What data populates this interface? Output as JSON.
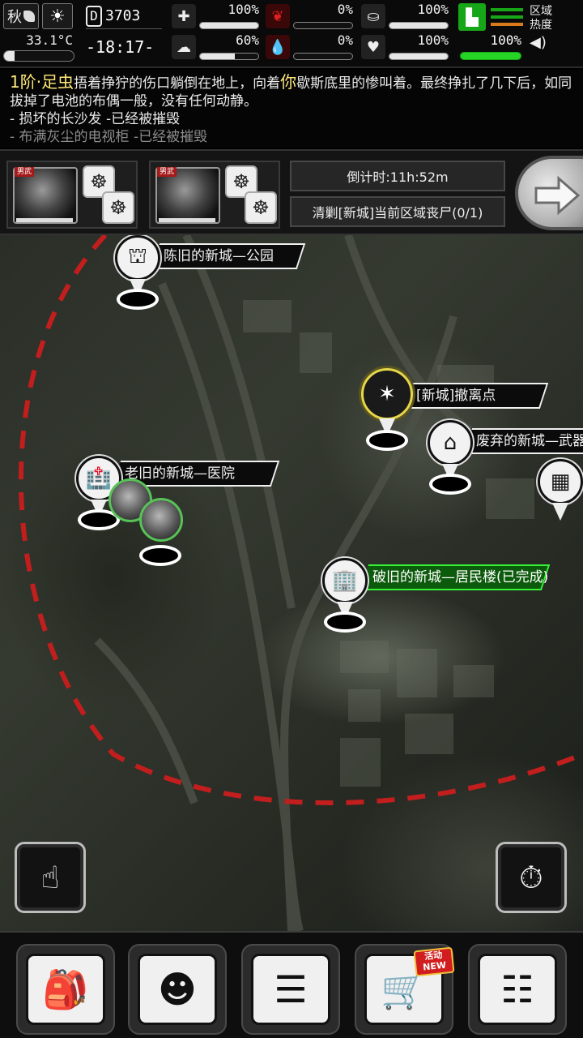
{
  "status": {
    "season": "秋",
    "weather_icon": "sun-icon",
    "temperature": "33.1°C",
    "temperature_level": 0.15,
    "day_prefix": "D",
    "day": "3703",
    "time": "-18:17-",
    "stats": [
      {
        "name": "medical",
        "icon": "first-aid-kit-icon",
        "value": "100%",
        "level": 1.0
      },
      {
        "name": "hunger",
        "icon": "stomach-icon",
        "value": "0%",
        "level": 0.0,
        "color": "#e02020"
      },
      {
        "name": "drink",
        "icon": "canteen-icon",
        "value": "100%",
        "level": 1.0
      },
      {
        "name": "mood",
        "icon": "brain-icon",
        "value": "60%",
        "level": 0.6
      },
      {
        "name": "thirst",
        "icon": "water-drop-icon",
        "value": "0%",
        "level": 0.0,
        "color": "#e02020"
      },
      {
        "name": "health",
        "icon": "heart-icon",
        "value": "100%",
        "level": 1.0
      }
    ],
    "stamina": {
      "icon": "boot-icon",
      "value": "100%",
      "level": 1.0,
      "color": "#26d426"
    },
    "zone_heat_label": "区域\n热度",
    "sound_icon": "speaker-icon"
  },
  "log": {
    "line1_tier": "1阶·足虫",
    "line1_mid": "捂着挣狞的伤口躺倒在地上，向着",
    "line1_you": "你",
    "line1_rest": "歇斯底里的惨叫着。最终挣扎了几下后，如同拔掉了电池的布偶一般，没有任何动静。",
    "line2": "- 损坏的长沙发 -已经被摧毁",
    "line3": "- 布满灰尘的电视柜 -已经被摧毁"
  },
  "party": {
    "members": [
      {
        "tag": "男武",
        "skill_icons": [
          "tribal-mask-icon",
          "tribal-mask-icon"
        ]
      },
      {
        "tag": "男武",
        "skill_icons": [
          "tribal-mask-icon",
          "tribal-mask-icon"
        ]
      }
    ],
    "countdown": "倒计时:11h:52m",
    "objective": "清剿[新城]当前区域丧尸(0/1)",
    "go_icon": "arrow-right-icon"
  },
  "map": {
    "locations": [
      {
        "label": "陈旧的新城—公园",
        "icon": "park-gate-icon"
      },
      {
        "label": "[新城]撤离点",
        "icon": "evacuation-icon",
        "highlight": "gold"
      },
      {
        "label": "废弃的新城—武器",
        "icon": "shop-icon"
      },
      {
        "label": "老旧的新城—医院",
        "icon": "hospital-icon"
      },
      {
        "label": "破旧的新城—居民楼(已完成)",
        "icon": "apartment-icon",
        "highlight": "green"
      },
      {
        "label": "",
        "icon": "warehouse-icon"
      }
    ],
    "zone_ring_color": "#c21e1e",
    "quick_action_icon": "tap-hand-arrow-icon",
    "wait_icon": "stopwatch-icon"
  },
  "toolbar": {
    "buttons": [
      {
        "name": "backpack",
        "icon": "backpack-icon"
      },
      {
        "name": "skills",
        "icon": "head-brain-icon"
      },
      {
        "name": "notes",
        "icon": "notebook-icon"
      },
      {
        "name": "shop",
        "icon": "shopping-cart-icon",
        "badge_top": "活动",
        "badge_bottom": "NEW"
      },
      {
        "name": "menu",
        "icon": "list-menu-icon"
      }
    ]
  }
}
